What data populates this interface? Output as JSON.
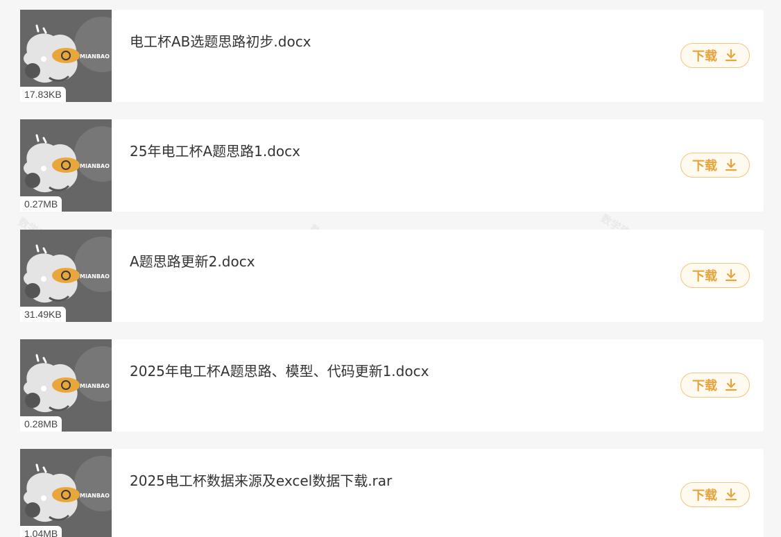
{
  "colors": {
    "accent": "#e8a33a",
    "button_border": "#f0c57d",
    "thumbnail_bg": "#6b6b6b"
  },
  "thumbnail_logo_text": "MIANBAO",
  "download_icon": "download-arrow-icon",
  "files": [
    {
      "name": "电工杯AB选题思路初步.docx",
      "size": "17.83KB",
      "download_label": "下载"
    },
    {
      "name": "25年电工杯A题思路1.docx",
      "size": "0.27MB",
      "download_label": "下载"
    },
    {
      "name": "A题思路更新2.docx",
      "size": "31.49KB",
      "download_label": "下载"
    },
    {
      "name": "2025年电工杯A题思路、模型、代码更新1.docx",
      "size": "0.28MB",
      "download_label": "下载"
    },
    {
      "name": "2025电工杯数据来源及excel数据下载.rar",
      "size": "1.04MB",
      "download_label": "下载"
    }
  ]
}
